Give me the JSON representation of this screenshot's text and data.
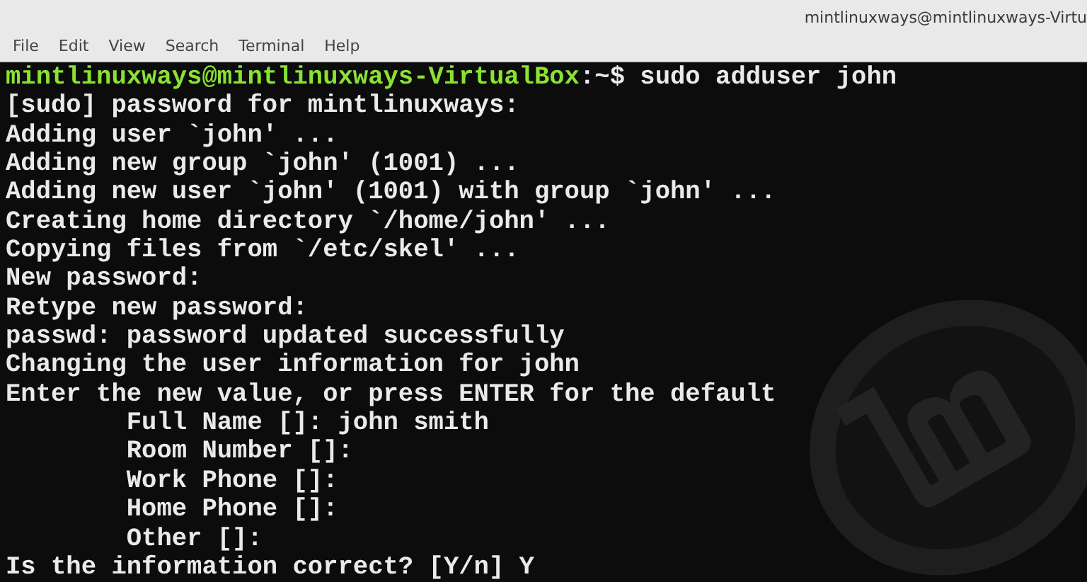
{
  "window": {
    "title": "mintlinuxways@mintlinuxways-Virtu"
  },
  "menu": [
    "File",
    "Edit",
    "View",
    "Search",
    "Terminal",
    "Help"
  ],
  "lines": [
    {
      "kind": "prompt",
      "user_host": "mintlinuxways@mintlinuxways-VirtualBox",
      "path": ":~$",
      "command": "sudo adduser john"
    },
    {
      "kind": "output",
      "text": "[sudo] password for mintlinuxways:"
    },
    {
      "kind": "output",
      "text": "Adding user `john' ..."
    },
    {
      "kind": "output",
      "text": "Adding new group `john' (1001) ..."
    },
    {
      "kind": "output",
      "text": "Adding new user `john' (1001) with group `john' ..."
    },
    {
      "kind": "output",
      "text": "Creating home directory `/home/john' ..."
    },
    {
      "kind": "output",
      "text": "Copying files from `/etc/skel' ..."
    },
    {
      "kind": "output",
      "text": "New password:"
    },
    {
      "kind": "output",
      "text": "Retype new password:"
    },
    {
      "kind": "output",
      "text": "passwd: password updated successfully"
    },
    {
      "kind": "output",
      "text": "Changing the user information for john"
    },
    {
      "kind": "output",
      "text": "Enter the new value, or press ENTER for the default"
    },
    {
      "kind": "output",
      "text": "        Full Name []: john smith"
    },
    {
      "kind": "output",
      "text": "        Room Number []:"
    },
    {
      "kind": "output",
      "text": "        Work Phone []:"
    },
    {
      "kind": "output",
      "text": "        Home Phone []:"
    },
    {
      "kind": "output",
      "text": "        Other []:"
    },
    {
      "kind": "output",
      "text": "Is the information correct? [Y/n] Y"
    }
  ]
}
